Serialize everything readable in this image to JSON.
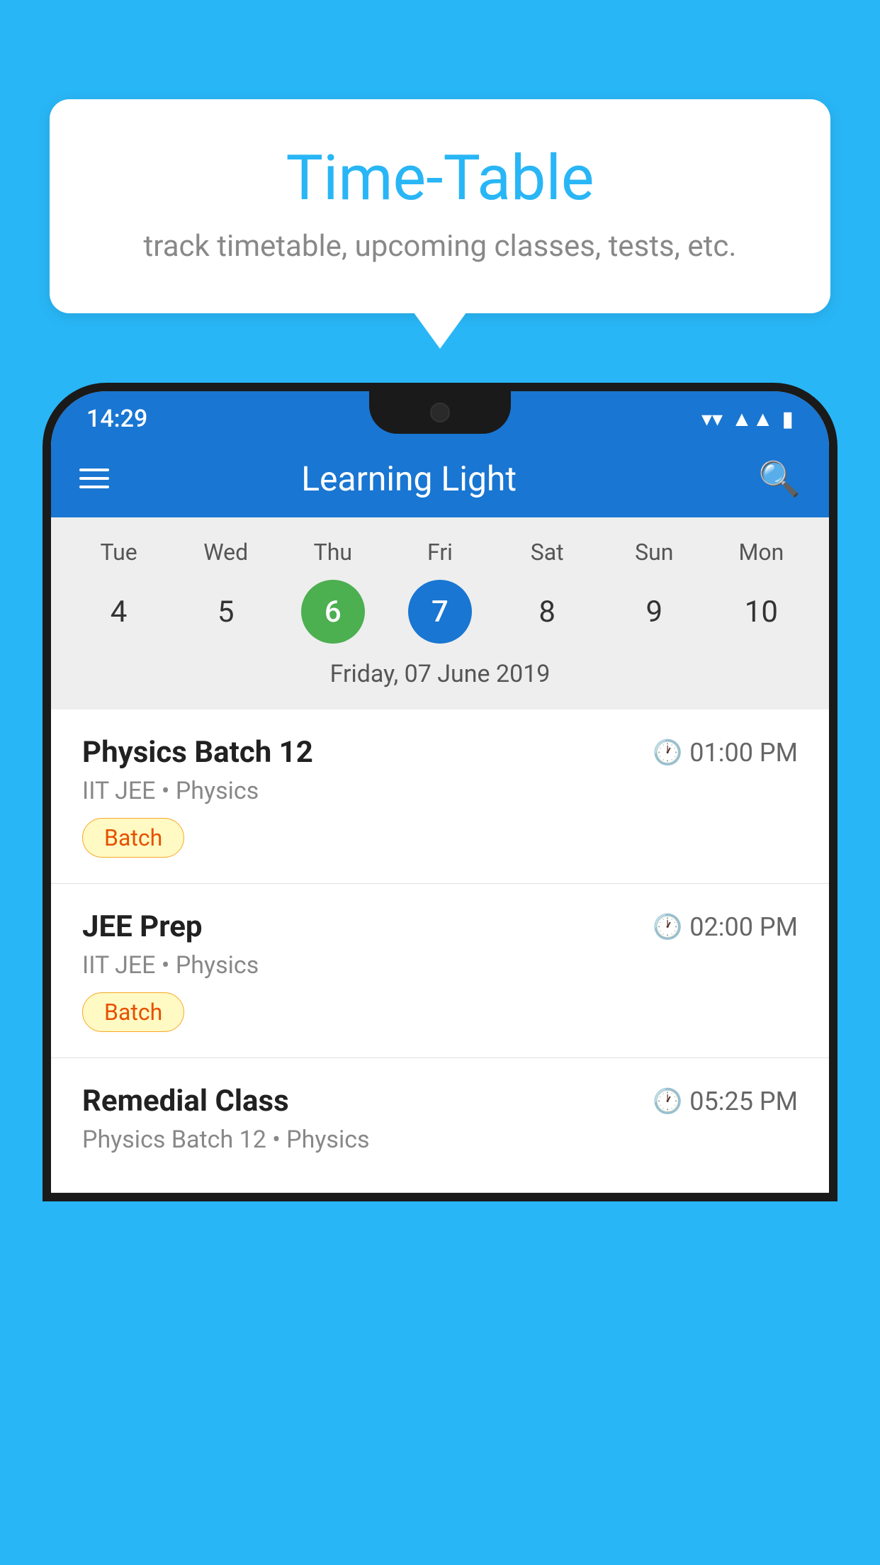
{
  "background_color": "#29B6F6",
  "tooltip": {
    "title": "Time-Table",
    "subtitle": "track timetable, upcoming classes, tests, etc."
  },
  "phone": {
    "status_bar": {
      "time": "14:29"
    },
    "app_bar": {
      "title": "Learning Light"
    },
    "calendar": {
      "days": [
        {
          "label": "Tue",
          "num": "4",
          "state": "normal"
        },
        {
          "label": "Wed",
          "num": "5",
          "state": "normal"
        },
        {
          "label": "Thu",
          "num": "6",
          "state": "today"
        },
        {
          "label": "Fri",
          "num": "7",
          "state": "selected"
        },
        {
          "label": "Sat",
          "num": "8",
          "state": "normal"
        },
        {
          "label": "Sun",
          "num": "9",
          "state": "normal"
        },
        {
          "label": "Mon",
          "num": "10",
          "state": "normal"
        }
      ],
      "selected_date_label": "Friday, 07 June 2019"
    },
    "schedule": [
      {
        "title": "Physics Batch 12",
        "time": "01:00 PM",
        "subtitle": "IIT JEE • Physics",
        "badge": "Batch"
      },
      {
        "title": "JEE Prep",
        "time": "02:00 PM",
        "subtitle": "IIT JEE • Physics",
        "badge": "Batch"
      },
      {
        "title": "Remedial Class",
        "time": "05:25 PM",
        "subtitle": "Physics Batch 12 • Physics",
        "badge": null
      }
    ]
  }
}
